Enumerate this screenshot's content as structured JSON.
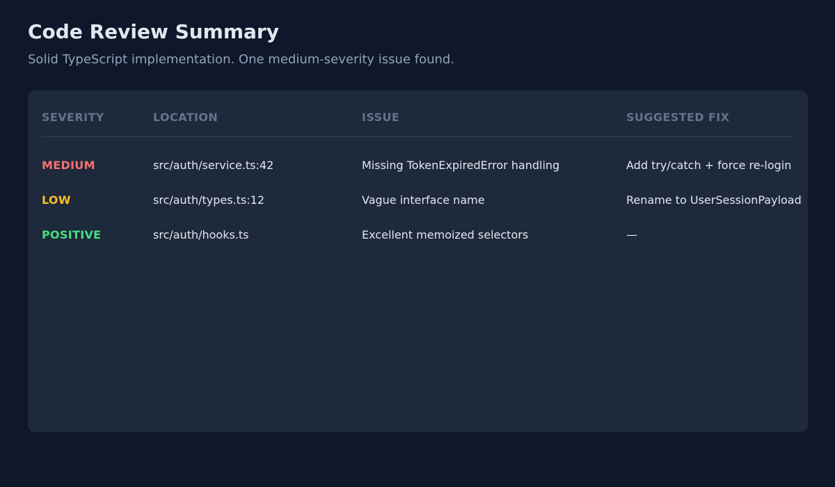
{
  "header": {
    "title": "Code Review Summary",
    "subtitle": "Solid TypeScript implementation. One medium-severity issue found."
  },
  "table": {
    "columns": [
      "SEVERITY",
      "LOCATION",
      "ISSUE",
      "SUGGESTED FIX"
    ],
    "rows": [
      {
        "severity": "MEDIUM",
        "location": "src/auth/service.ts:42",
        "issue": "Missing TokenExpiredError handling",
        "fix": "Add try/catch + force re-login"
      },
      {
        "severity": "LOW",
        "location": "src/auth/types.ts:12",
        "issue": "Vague interface name",
        "fix": "Rename to UserSessionPayload"
      },
      {
        "severity": "POSITIVE",
        "location": "src/auth/hooks.ts",
        "issue": "Excellent memoized selectors",
        "fix": "—"
      }
    ]
  },
  "colors": {
    "background": "#0f172a",
    "card": "#1e293b",
    "medium": "#f87171",
    "low": "#fbbf24",
    "positive": "#4ade80"
  }
}
